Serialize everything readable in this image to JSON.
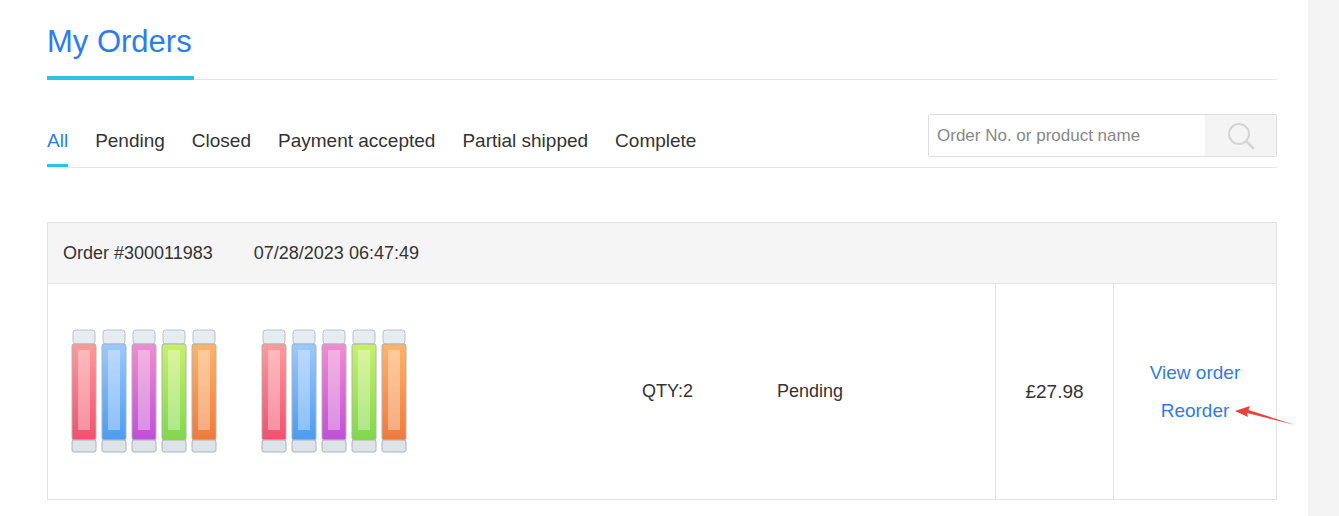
{
  "page": {
    "title": "My Orders"
  },
  "tabs": [
    {
      "label": "All",
      "selected": true
    },
    {
      "label": "Pending",
      "selected": false
    },
    {
      "label": "Closed",
      "selected": false
    },
    {
      "label": "Payment accepted",
      "selected": false
    },
    {
      "label": "Partial shipped",
      "selected": false
    },
    {
      "label": "Complete",
      "selected": false
    }
  ],
  "search": {
    "placeholder": "Order No. or product name"
  },
  "orders": [
    {
      "number": "Order #300011983",
      "date": "07/28/2023 06:47:49",
      "product_images": 2,
      "qty": "QTY:2",
      "status": "Pending",
      "total": "£27.98",
      "actions": [
        {
          "label": "View order"
        },
        {
          "label": "Reorder"
        }
      ]
    }
  ],
  "annotations": [
    {
      "kind": "arrow",
      "points_to": "Reorder"
    }
  ]
}
